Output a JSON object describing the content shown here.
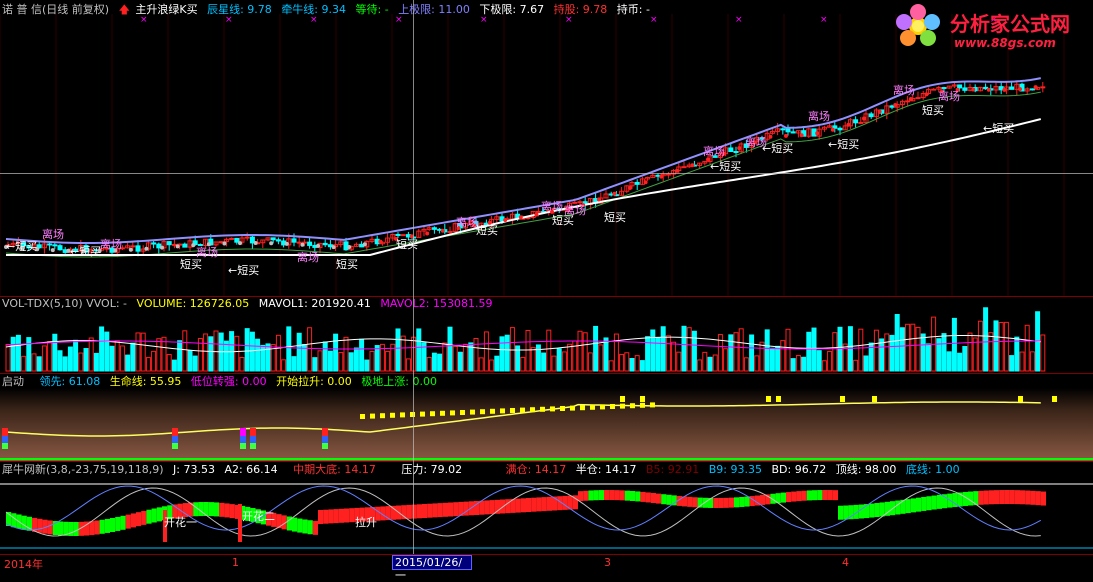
{
  "main": {
    "title": "诺 普 信(日线 前复权)",
    "signal_label": "主升浪绿K买",
    "items": [
      {
        "label": "辰星线: 9.78",
        "color": "#00c0ff"
      },
      {
        "label": "牵牛线: 9.34",
        "color": "#00c0ff"
      },
      {
        "label": "等待: -",
        "color": "#00ff00"
      },
      {
        "label": "上极限: 11.00",
        "color": "#8080ff"
      },
      {
        "label": "下极限: 7.67",
        "color": "#ffffff"
      },
      {
        "label": "持股: 9.78",
        "color": "#ff3030"
      },
      {
        "label": "持币: -",
        "color": "#ffffff"
      }
    ],
    "annotations": {
      "leave": "离场",
      "short_buy": "短买",
      "short_buy_arrow": "←短买"
    }
  },
  "volume": {
    "name": "VOL-TDX(5,10) VVOL: -",
    "items": [
      {
        "label": "VOLUME: 126726.05",
        "color": "#ffff00"
      },
      {
        "label": "MAVOL1: 201920.41",
        "color": "#ffffff"
      },
      {
        "label": "MAVOL2: 153081.59",
        "color": "#ff00ff"
      }
    ]
  },
  "launch": {
    "name": "启动",
    "items": [
      {
        "label": "领先: 61.08",
        "color": "#00c0ff"
      },
      {
        "label": "生命线: 55.95",
        "color": "#ffff00"
      },
      {
        "label": "低位转强: 0.00",
        "color": "#ff00ff"
      },
      {
        "label": "开始拉升: 0.00",
        "color": "#ffff00"
      },
      {
        "label": "极地上涨: 0.00",
        "color": "#00ff00"
      }
    ]
  },
  "bull": {
    "name": "犀牛网新(3,8,-23,75,19,118,9)",
    "items": [
      {
        "label": "J: 73.53",
        "color": "#ffffff"
      },
      {
        "label": "A2: 66.14",
        "color": "#ffffff"
      },
      {
        "label": "中期大底: 14.17",
        "color": "#ff3030"
      },
      {
        "label": "压力: 79.02",
        "color": "#ffffff"
      },
      {
        "label": "满仓: 14.17",
        "color": "#ff3030"
      },
      {
        "label": "半仓: 14.17",
        "color": "#ffffff"
      },
      {
        "label": "B5: 92.91",
        "color": "#800000"
      },
      {
        "label": "B9: 93.35",
        "color": "#00c0ff"
      },
      {
        "label": "BD: 96.72",
        "color": "#ffffff"
      },
      {
        "label": "顶线: 98.00",
        "color": "#ffffff"
      },
      {
        "label": "底线: 1.00",
        "color": "#00c0ff"
      }
    ],
    "annotations": {
      "flower1": "开花一",
      "flower2": "开花二",
      "lift": "拉升"
    }
  },
  "xaxis": {
    "labels": [
      "2014年",
      "1",
      "3",
      "4"
    ],
    "selected_date": "2015/01/26/一"
  },
  "logo": {
    "title": "分析家公式网",
    "url": "www.88gs.com"
  },
  "colors": {
    "up": "#ff2020",
    "down": "#00ffff",
    "bg": "#000000",
    "grid": "#800000"
  }
}
